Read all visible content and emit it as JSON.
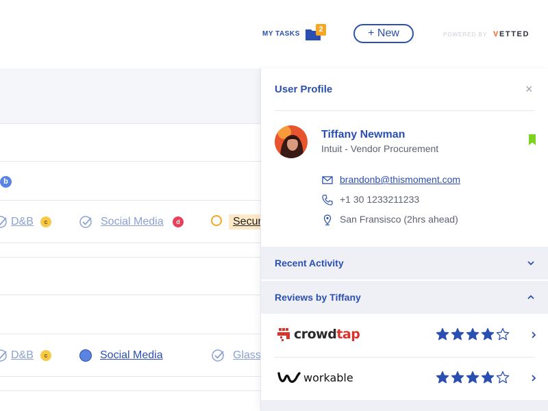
{
  "header": {
    "my_tasks_label": "MY TASKS",
    "tasks_count": "2",
    "new_button_label": "+ New",
    "powered_by": "POWERED BY",
    "brand_first": "V",
    "brand_rest": "ETTED"
  },
  "background": {
    "b_badge": "b",
    "row1": {
      "link1": "D&B",
      "tag1": "c",
      "link2": "Social Media",
      "tag2": "d",
      "link3": "Secur"
    },
    "row2": {
      "link1": "D&B",
      "tag1": "c",
      "link2": "Social Media",
      "link3": "Glass"
    }
  },
  "profile": {
    "title": "User Profile",
    "close_label": "×",
    "name": "Tiffany Newman",
    "org": "Intuit - Vendor Procurement",
    "email": "brandonb@thismoment.com",
    "phone": "+1 30 1233211233",
    "location": "San Fransisco (2hrs ahead)",
    "bookmark_color": "#7ed321"
  },
  "sections": {
    "recent_activity": "Recent Activity",
    "reviews": "Reviews by Tiffany"
  },
  "reviews": [
    {
      "company": "crowdtap",
      "company_first": "crowd",
      "company_second": "tap",
      "rating": 4,
      "max": 5
    },
    {
      "company": "workable",
      "rating": 4,
      "max": 5
    }
  ],
  "colors": {
    "accent": "#2a4fb0",
    "badge_orange": "#f5a623",
    "brand_orange": "#ff5a1f",
    "crowdtap_red": "#d9342b"
  }
}
